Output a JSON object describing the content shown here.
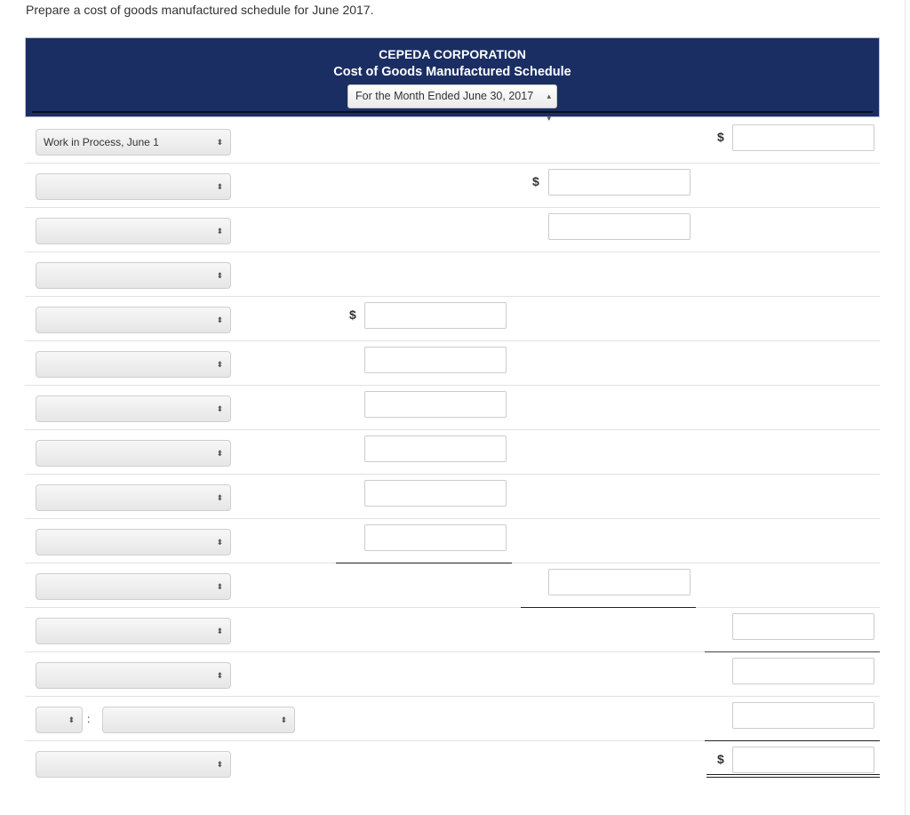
{
  "instruction": "Prepare a cost of goods manufactured schedule for June 2017.",
  "header": {
    "company": "CEPEDA CORPORATION",
    "title": "Cost of Goods Manufactured Schedule",
    "period_select": "For the Month Ended June 30, 2017",
    "header_color": "#1b2e63"
  },
  "currency_symbol": "$",
  "rows": [
    {
      "label_select": "Work in Process, June 1",
      "inputs": {
        "C": ""
      },
      "dollar": [
        "C"
      ]
    },
    {
      "label_select": "",
      "inputs": {
        "B": ""
      },
      "dollar": [
        "B"
      ]
    },
    {
      "label_select": "",
      "inputs": {
        "B": ""
      },
      "dollar": []
    },
    {
      "label_select": "",
      "inputs": {},
      "dollar": []
    },
    {
      "label_select": "",
      "inputs": {
        "A": ""
      },
      "dollar": [
        "A"
      ]
    },
    {
      "label_select": "",
      "inputs": {
        "A": ""
      },
      "dollar": []
    },
    {
      "label_select": "",
      "inputs": {
        "A": ""
      },
      "dollar": []
    },
    {
      "label_select": "",
      "inputs": {
        "A": ""
      },
      "dollar": []
    },
    {
      "label_select": "",
      "inputs": {
        "A": ""
      },
      "dollar": []
    },
    {
      "label_select": "",
      "inputs": {
        "A": ""
      },
      "dollar": []
    },
    {
      "label_select": "",
      "inputs": {
        "B": ""
      },
      "dollar": []
    },
    {
      "label_select": "",
      "inputs": {
        "C": ""
      },
      "dollar": []
    },
    {
      "label_select": "",
      "inputs": {
        "C": ""
      },
      "dollar": []
    },
    {
      "label_select_prefix": "",
      "label_select": "",
      "inputs": {
        "C": ""
      },
      "dollar": []
    },
    {
      "label_select": "",
      "inputs": {
        "C": ""
      },
      "dollar": [
        "C"
      ]
    }
  ],
  "arrow_glyph": "⬍"
}
